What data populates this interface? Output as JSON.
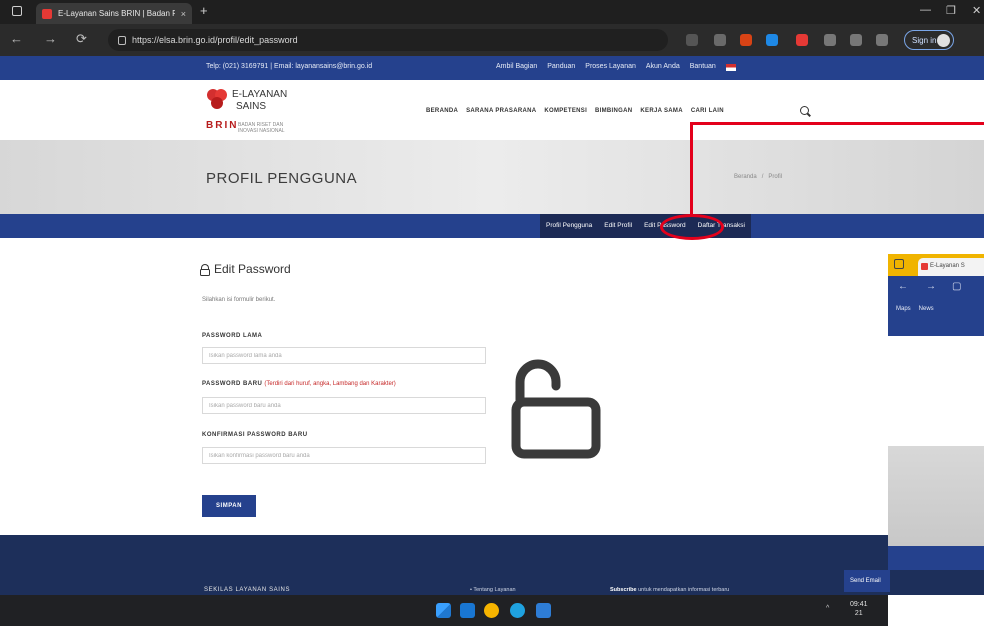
{
  "browser": {
    "tab_title": "E-Layanan Sains BRIN | Badan Ri...",
    "tab_close": "×",
    "new_tab": "+",
    "url": "https://elsa.brin.go.id/profil/edit_password",
    "signin_label": "Sign in"
  },
  "site": {
    "infobar_contact": "Telp: (021) 3169791 | Email: layanansains@brin.go.id",
    "infobar_links": [
      "Ambil Bagian",
      "Panduan",
      "Proses Layanan",
      "Akun Anda",
      "Bantuan"
    ],
    "brand_line1": "E-LAYANAN",
    "brand_line2": "SAINS",
    "brin": "BRIN",
    "brin_sub": "BADAN RISET DAN INOVASI NASIONAL",
    "nav": [
      "BERANDA",
      "SARANA PRASARANA",
      "KOMPETENSI",
      "BIMBINGAN",
      "KERJA SAMA",
      "CARI LAIN"
    ],
    "page_title": "PROFIL PENGGUNA",
    "breadcrumb": [
      "Beranda",
      "/",
      "Profil"
    ],
    "subnav": [
      "Profil Pengguna",
      "Edit Profil",
      "Edit Password",
      "Daftar Transaksi"
    ]
  },
  "form": {
    "title": "Edit Password",
    "description": "Silahkan isi formulir berikut.",
    "old_label": "PASSWORD LAMA",
    "old_placeholder": "Isikan password lama anda",
    "new_label": "PASSWORD BARU",
    "new_hint": "(Terdiri dari huruf, angka, Lambang dan Karakter)",
    "new_placeholder": "Isikan password baru anda",
    "confirm_label": "KONFIRMASI PASSWORD BARU",
    "confirm_placeholder": "Isikan konfirmasi password baru anda",
    "save_label": "SIMPAN"
  },
  "footer": {
    "col_a": "SEKILAS LAYANAN SAINS",
    "col_b": "• Tentang Layanan",
    "col_c_bold": "Subscribe",
    "col_c_rest": " untuk mendapatkan informasi terbaru",
    "send_btn": "Send Email"
  },
  "taskbar": {
    "time_line1": "09:41",
    "time_line2": "21"
  },
  "second_window": {
    "tab": "E-Layanan S",
    "bookmarks": [
      "Maps",
      "News"
    ]
  },
  "colors": {
    "brand_blue": "#25418d",
    "footer_navy": "#1d2f5a",
    "callout_red": "#e3001b"
  }
}
